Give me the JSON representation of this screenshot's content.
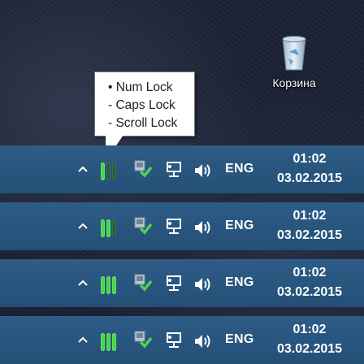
{
  "desktop": {
    "recycle_bin_label": "Корзина"
  },
  "tooltip": {
    "lines": [
      "• Num Lock",
      "- Caps Lock",
      "- Scroll Lock"
    ]
  },
  "taskbars": [
    {
      "locks": [
        true,
        false,
        false
      ],
      "lang": "ENG",
      "time": "01:02",
      "date": "03.02.2015"
    },
    {
      "locks": [
        true,
        true,
        false
      ],
      "lang": "ENG",
      "time": "01:02",
      "date": "03.02.2015"
    },
    {
      "locks": [
        true,
        true,
        true
      ],
      "lang": "ENG",
      "time": "01:02",
      "date": "03.02.2015"
    },
    {
      "locks": [
        true,
        true,
        true
      ],
      "lang": "ENG",
      "time": "01:02",
      "date": "03.02.2015"
    }
  ],
  "colors": {
    "taskbar": "#2d5c86",
    "lock_on": "#3ed63e",
    "lock_off": "#2f5a40",
    "defender_check": "#4fd24f"
  },
  "icons": [
    "chevron-up-icon",
    "lock-indicator-icon",
    "defender-icon",
    "network-icon",
    "volume-icon",
    "recycle-bin-icon"
  ]
}
